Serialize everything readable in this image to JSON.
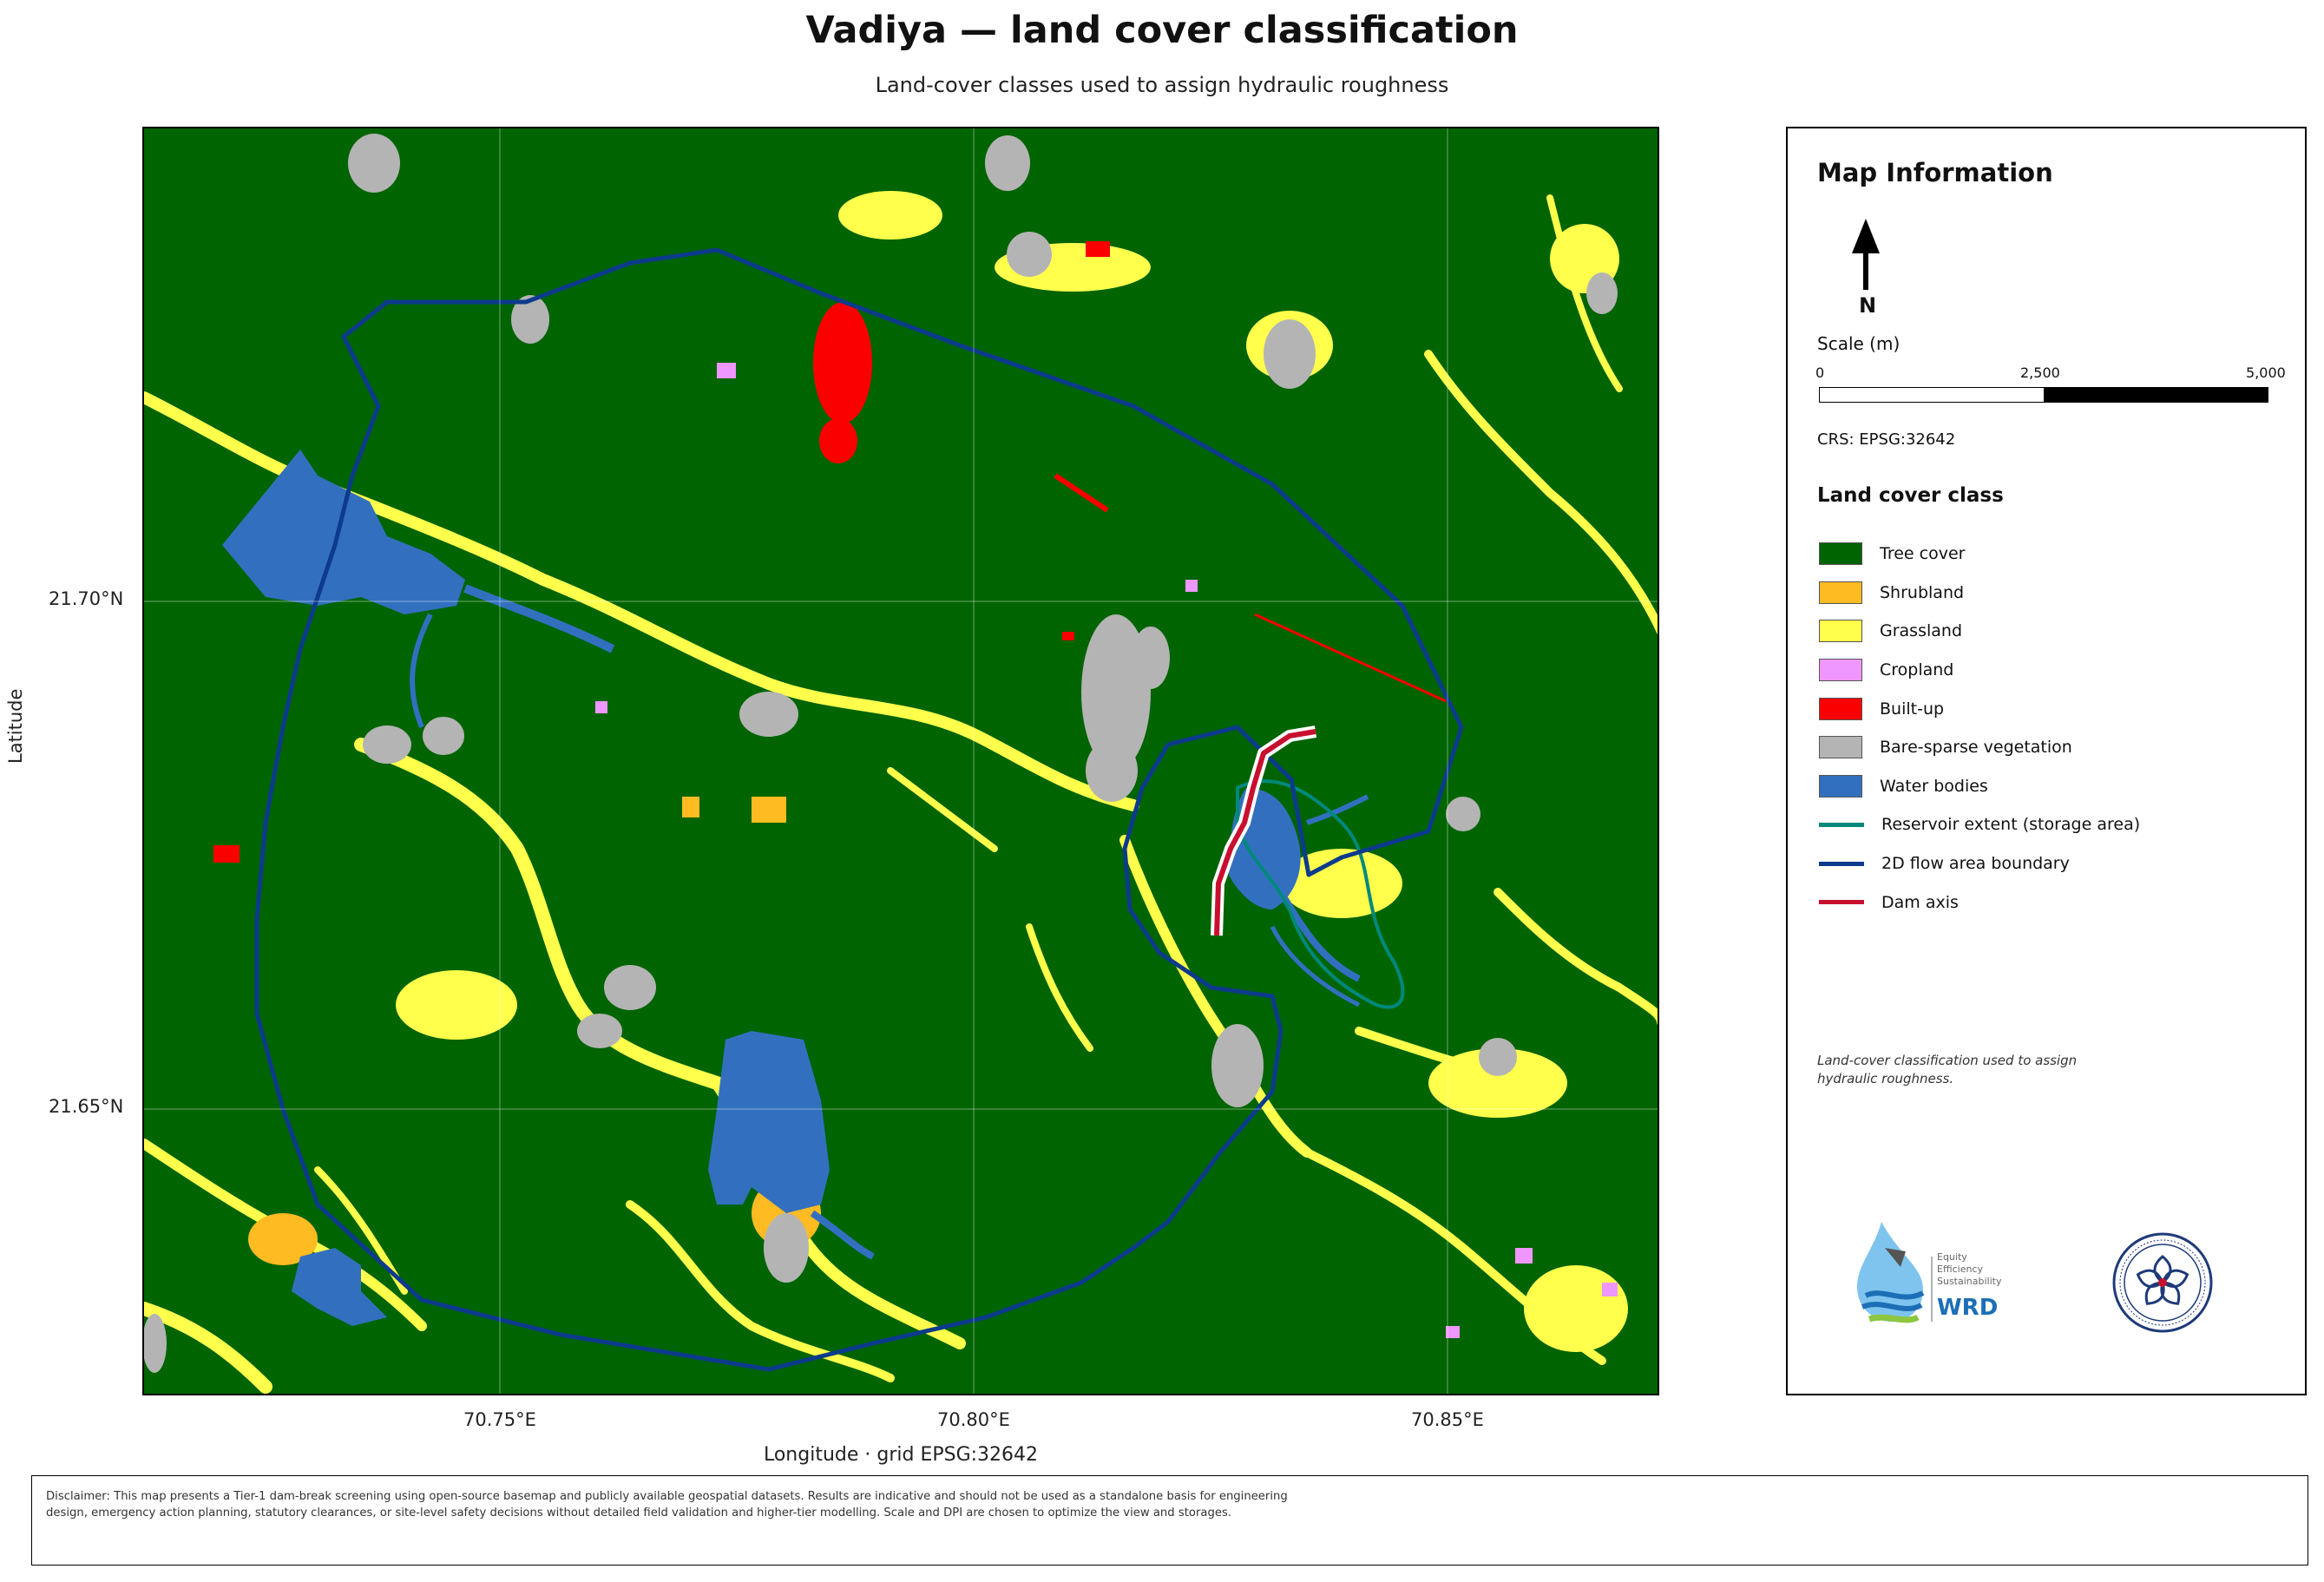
{
  "title": "Vadiya — land cover classification",
  "subtitle": "Land-cover classes used to assign hydraulic roughness",
  "axes": {
    "ylabel": "Latitude",
    "xlabel": "Longitude   ·   grid EPSG:32642",
    "y_ticks": [
      "21.70°N",
      "21.65°N"
    ],
    "x_ticks": [
      "70.75°E",
      "70.80°E",
      "70.85°E"
    ]
  },
  "panel": {
    "title": "Map Information",
    "north_label": "N",
    "scale_label": "Scale (m)",
    "scale_ticks": [
      "0",
      "2,500",
      "5,000"
    ],
    "crs": "CRS: EPSG:32642",
    "legend_title": "Land cover class",
    "legend": [
      {
        "label": "Tree cover",
        "color": "#006400",
        "kind": "fill"
      },
      {
        "label": "Shrubland",
        "color": "#FFBB22",
        "kind": "fill"
      },
      {
        "label": "Grassland",
        "color": "#FFFF4C",
        "kind": "fill"
      },
      {
        "label": "Cropland",
        "color": "#F096FF",
        "kind": "fill"
      },
      {
        "label": "Built-up",
        "color": "#FA0000",
        "kind": "fill"
      },
      {
        "label": "Bare-sparse vegetation",
        "color": "#B4B4B4",
        "kind": "fill"
      },
      {
        "label": "Water bodies",
        "color": "#3270BF",
        "kind": "fill"
      },
      {
        "label": "Reservoir extent (storage area)",
        "color": "#00897B",
        "kind": "line"
      },
      {
        "label": "2D flow area boundary",
        "color": "#0D3B8C",
        "kind": "line"
      },
      {
        "label": "Dam axis",
        "color": "#C8102E",
        "kind": "line"
      }
    ],
    "note": "Land-cover classification used to assign hydraulic roughness.",
    "logo_wrd": {
      "line1": "Equity",
      "line2": "Efficiency",
      "line3": "Sustainability",
      "brand": "WRD"
    }
  },
  "disclaimer": "Disclaimer: This map presents a Tier-1 dam-break screening using open-source basemap and publicly available geospatial datasets. Results are indicative and should not be used as a standalone basis for engineering design, emergency action planning, statutory clearances, or site-level safety decisions without detailed field validation and higher-tier modelling. Scale and DPI are chosen to optimize the view and storages."
}
